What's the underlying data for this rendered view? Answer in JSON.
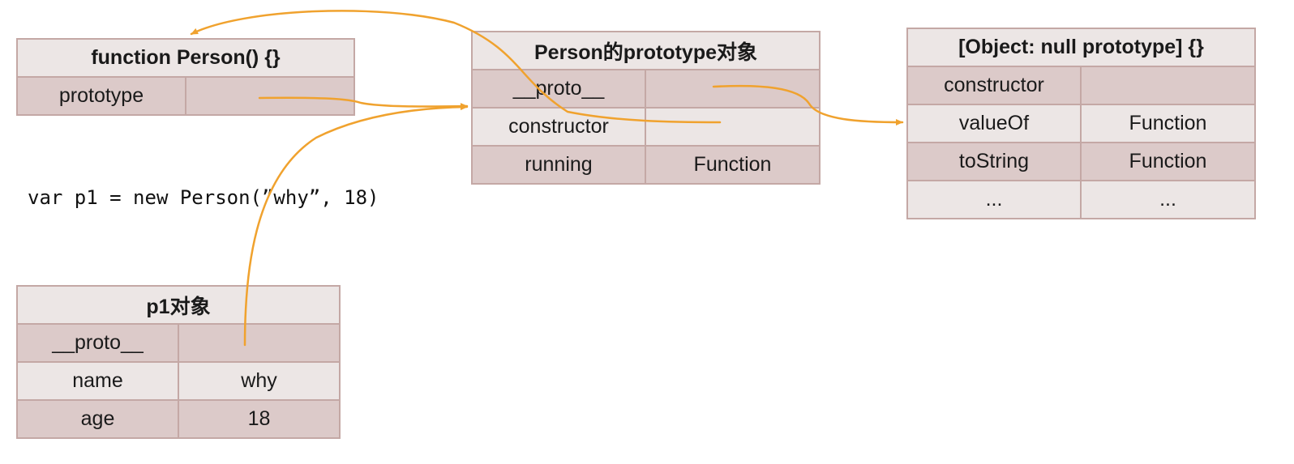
{
  "person_function": {
    "title": "function Person() {}",
    "rows": [
      {
        "key": "prototype",
        "value": ""
      }
    ]
  },
  "person_prototype": {
    "title": "Person的prototype对象",
    "rows": [
      {
        "key": "__proto__",
        "value": ""
      },
      {
        "key": "constructor",
        "value": ""
      },
      {
        "key": "running",
        "value": "Function"
      }
    ]
  },
  "null_prototype_object": {
    "title": "[Object: null prototype] {}",
    "rows": [
      {
        "key": "constructor",
        "value": ""
      },
      {
        "key": "valueOf",
        "value": "Function"
      },
      {
        "key": "toString",
        "value": "Function"
      },
      {
        "key": "...",
        "value": "..."
      }
    ]
  },
  "p1_object": {
    "title": "p1对象",
    "rows": [
      {
        "key": "__proto__",
        "value": ""
      },
      {
        "key": "name",
        "value": "why"
      },
      {
        "key": "age",
        "value": "18"
      }
    ]
  },
  "code_line": "var p1 = new Person(”why”, 18)",
  "colors": {
    "arrow": "#f0a22e",
    "cell_border": "#c4a8a5",
    "row_shade": "#dccac9",
    "row_light": "#ece6e5"
  }
}
